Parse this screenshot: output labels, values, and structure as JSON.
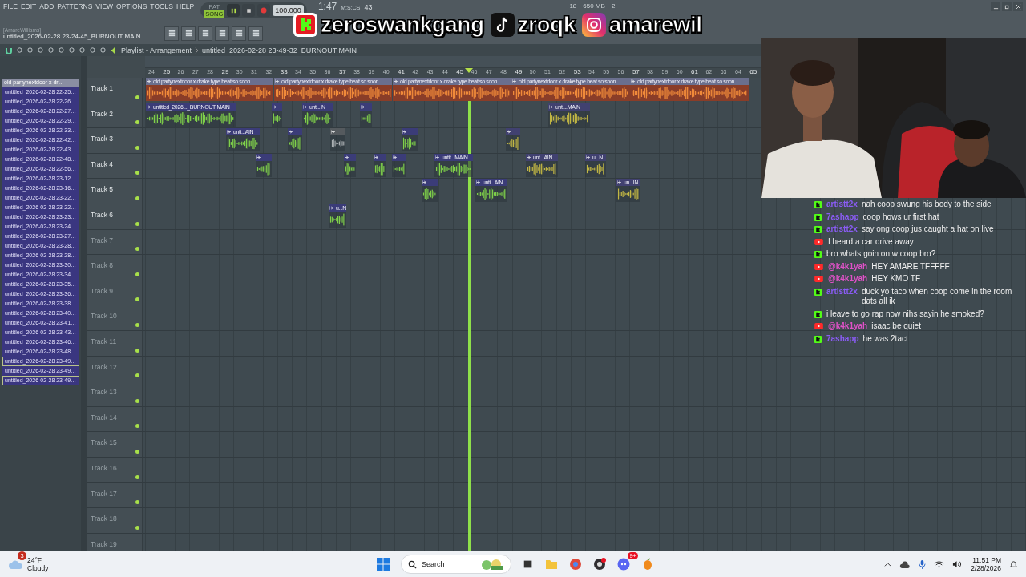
{
  "menu": [
    "FILE",
    "EDIT",
    "ADD",
    "PATTERNS",
    "VIEW",
    "OPTIONS",
    "TOOLS",
    "HELP"
  ],
  "transport": {
    "modes": [
      {
        "label": "PAT",
        "selected": false
      },
      {
        "label": "SONG",
        "selected": true
      }
    ],
    "tempo": "100.000",
    "time": "1:47",
    "time_cs": "43",
    "time_unit": "M:S:CS",
    "cpu": "18",
    "memory": "650 MB",
    "voices": "2"
  },
  "project": {
    "user": "[AmareWilliams]",
    "title": "untitled_2026-02-28 23-24-45_BURNOUT MAIN"
  },
  "breadcrumb": {
    "window": "Playlist - Arrangement",
    "pattern": "untitled_2026-02-28 23-49-32_BURNOUT MAIN"
  },
  "overlay": {
    "handles": [
      {
        "kind": "kick",
        "text": "zeroswankgang"
      },
      {
        "kind": "tiktok",
        "text": "zroqk"
      },
      {
        "kind": "instagram",
        "text": "amarewil"
      }
    ]
  },
  "browser": {
    "header": "old partynextdoor x dr…",
    "items": [
      {
        "label": "untitled_2026-02-28 22-25…",
        "selected": false
      },
      {
        "label": "untitled_2026-02-28 22-26…",
        "selected": false
      },
      {
        "label": "untitled_2026-02-28 22-27…",
        "selected": false
      },
      {
        "label": "untitled_2026-02-28 22-29…",
        "selected": false
      },
      {
        "label": "untitled_2026-02-28 22-33…",
        "selected": false
      },
      {
        "label": "untitled_2026-02-28 22-42…",
        "selected": false
      },
      {
        "label": "untitled_2026-02-28 22-43…",
        "selected": false
      },
      {
        "label": "untitled_2026-02-28 22-48…",
        "selected": false
      },
      {
        "label": "untitled_2026-02-28 22-56…",
        "selected": false
      },
      {
        "label": "untitled_2026-02-28 23-12…",
        "selected": false
      },
      {
        "label": "untitled_2026-02-28 23-16…",
        "selected": false
      },
      {
        "label": "untitled_2026-02-28 23-22…",
        "selected": false
      },
      {
        "label": "untitled_2026-02-28 23-22…",
        "selected": false
      },
      {
        "label": "untitled_2026-02-28 23-23…",
        "selected": false
      },
      {
        "label": "untitled_2026-02-28 23-24…",
        "selected": false
      },
      {
        "label": "untitled_2026-02-28 23-27…",
        "selected": false
      },
      {
        "label": "untitled_2026-02-28 23-28…",
        "selected": false
      },
      {
        "label": "untitled_2026-02-28 23-28…",
        "selected": false
      },
      {
        "label": "untitled_2026-02-28 23-30…",
        "selected": false
      },
      {
        "label": "untitled_2026-02-28 23-34…",
        "selected": false
      },
      {
        "label": "untitled_2026-02-28 23-35…",
        "selected": false
      },
      {
        "label": "untitled_2026-02-28 23-36…",
        "selected": false
      },
      {
        "label": "untitled_2026-02-28 23-38…",
        "selected": false
      },
      {
        "label": "untitled_2026-02-28 23-40…",
        "selected": false
      },
      {
        "label": "untitled_2026-02-28 23-41…",
        "selected": false
      },
      {
        "label": "untitled_2026-02-28 23-43…",
        "selected": false
      },
      {
        "label": "untitled_2026-02-28 23-46…",
        "selected": false
      },
      {
        "label": "untitled_2026-02-28 23-48…",
        "selected": false
      },
      {
        "label": "untitled_2026-02-28 23-49…",
        "selected": true
      },
      {
        "label": "untitled_2026-02-28 23-49…",
        "selected": false
      },
      {
        "label": "untitled_2026-02-28 23-49…",
        "selected": true
      }
    ]
  },
  "ruler": [
    "24",
    "25",
    "26",
    "27",
    "28",
    "29",
    "30",
    "31",
    "32",
    "33",
    "34",
    "35",
    "36",
    "37",
    "38",
    "39",
    "40",
    "41",
    "42",
    "43",
    "44",
    "45",
    "46",
    "47",
    "48",
    "49",
    "50",
    "51",
    "52",
    "53",
    "54",
    "55",
    "56",
    "57",
    "58",
    "59",
    "60",
    "61",
    "62",
    "63",
    "64",
    "65"
  ],
  "tracks": [
    {
      "name": "Track 1",
      "empty": false,
      "clips": [
        {
          "kind": "beat",
          "label": "old partynextdoor x drake type beat so soon"
        },
        {
          "kind": "beat",
          "label": "old partynextdoor x drake type beat so soon"
        },
        {
          "kind": "beat",
          "label": "old partynextdoor x drake type beat so soon"
        },
        {
          "kind": "beat",
          "label": "old partynextdoor x drake type beat so soon"
        },
        {
          "kind": "beat",
          "label": "old partynextdoor x drake type beat so soon"
        }
      ]
    },
    {
      "name": "Track 2",
      "empty": false,
      "clips": [
        {
          "kind": "vocal",
          "label": "untitled_2026..._BURNOUT MAIN"
        },
        {
          "kind": "vocal"
        },
        {
          "kind": "vocal",
          "label": "unt...IN"
        },
        {
          "kind": "vocal"
        },
        {
          "kind": "faded",
          "label": "unti...MAIN"
        }
      ]
    },
    {
      "name": "Track 3",
      "empty": false,
      "clips": [
        {
          "kind": "vocal",
          "label": "unti...AIN"
        },
        {
          "kind": "vocal"
        },
        {
          "kind": "muted"
        },
        {
          "kind": "vocal"
        },
        {
          "kind": "faded"
        }
      ]
    },
    {
      "name": "Track 4",
      "empty": false,
      "clips": [
        {
          "kind": "vocal"
        },
        {
          "kind": "vocal"
        },
        {
          "kind": "vocal"
        },
        {
          "kind": "vocal"
        },
        {
          "kind": "vocal",
          "label": "untit...MAIN"
        },
        {
          "kind": "faded",
          "label": "unt...AIN"
        },
        {
          "kind": "faded",
          "label": "u...N"
        }
      ]
    },
    {
      "name": "Track 5",
      "empty": false,
      "clips": [
        {
          "kind": "vocal"
        },
        {
          "kind": "vocal",
          "label": "unti...AIN"
        },
        {
          "kind": "faded",
          "label": "un...IN"
        }
      ]
    },
    {
      "name": "Track 6",
      "empty": false,
      "clips": [
        {
          "kind": "vocal",
          "label": "u...N"
        }
      ]
    },
    {
      "name": "Track 7",
      "empty": true
    },
    {
      "name": "Track 8",
      "empty": true
    },
    {
      "name": "Track 9",
      "empty": true
    },
    {
      "name": "Track 10",
      "empty": true
    },
    {
      "name": "Track 11",
      "empty": true
    },
    {
      "name": "Track 12",
      "empty": true
    },
    {
      "name": "Track 13",
      "empty": true
    },
    {
      "name": "Track 14",
      "empty": true
    },
    {
      "name": "Track 15",
      "empty": true
    },
    {
      "name": "Track 16",
      "empty": true
    },
    {
      "name": "Track 17",
      "empty": true
    },
    {
      "name": "Track 18",
      "empty": true
    },
    {
      "name": "Track 19",
      "empty": true
    }
  ],
  "chat": [
    {
      "kind": "kick",
      "user": "artistt2x",
      "color": "#8b5cf6",
      "text": "nah coop swung his body to the side"
    },
    {
      "kind": "kick",
      "user": "7ashapp",
      "color": "#8b5cf6",
      "text": "coop hows ur first hat"
    },
    {
      "kind": "kick",
      "user": "artistt2x",
      "color": "#8b5cf6",
      "text": "say ong coop jus caught a hat on live"
    },
    {
      "kind": "youtube",
      "text": "I heard a car drive away"
    },
    {
      "kind": "kick",
      "text": "bro whats goin on w coop bro?"
    },
    {
      "kind": "youtube",
      "user": "@k4k1yah",
      "color": "#e052c8",
      "text": "HEY AMARE TFFFFF"
    },
    {
      "kind": "youtube",
      "user": "@k4k1yah",
      "color": "#e052c8",
      "text": "HEY KMO TF"
    },
    {
      "kind": "kick",
      "user": "artistt2x",
      "color": "#8b5cf6",
      "text": "duck yo taco when coop come in the room dats all ik"
    },
    {
      "kind": "kick",
      "text": "i leave to go rap now nihs sayin he smoked?"
    },
    {
      "kind": "youtube",
      "user": "@k4k1yah",
      "color": "#e052c8",
      "text": "isaac be quiet"
    },
    {
      "kind": "kick",
      "user": "7ashapp",
      "color": "#8b5cf6",
      "text": "he was 2tact"
    }
  ],
  "taskbar": {
    "weather": {
      "temp": "24°F",
      "condition": "Cloudy",
      "badge": "3"
    },
    "search": "Search",
    "discord_badge": "9+",
    "time": "11:51 PM",
    "date": "2/28/2026"
  }
}
